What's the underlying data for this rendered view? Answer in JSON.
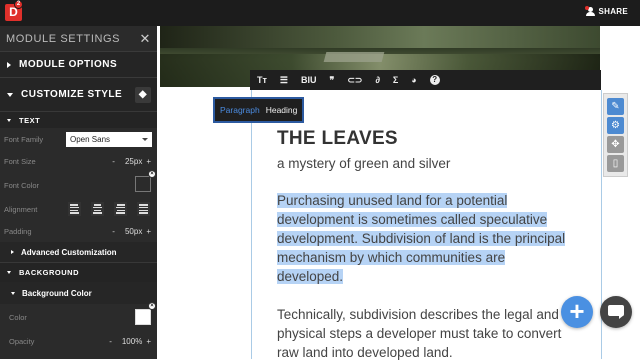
{
  "topbar": {
    "logo_letter": "D",
    "logo_badge": "2",
    "share_label": "SHARE"
  },
  "panel": {
    "header_title": "MODULE SETTINGS",
    "close_glyph": "✕",
    "module_options": "MODULE OPTIONS",
    "customize_style": "CUSTOMIZE STYLE",
    "text_section": "TEXT",
    "font_family_label": "Font Family",
    "font_family_value": "Open Sans",
    "font_size_label": "Font Size",
    "font_size_value": "25px",
    "font_color_label": "Font Color",
    "alignment_label": "Alignment",
    "padding_label": "Padding",
    "padding_value": "50px",
    "advanced_label": "Advanced Customization",
    "background_section": "BACKGROUND",
    "background_color_label": "Background Color",
    "color_label": "Color",
    "opacity_label": "Opacity",
    "opacity_value": "100%",
    "minus": "-",
    "plus": "+"
  },
  "toolbar": {
    "items": [
      "Tт",
      "☰",
      "BIU",
      "❞",
      "🔗",
      "📎",
      "Σ",
      "◕",
      "?"
    ]
  },
  "tabs": {
    "paragraph": "Paragraph",
    "heading": "Heading"
  },
  "content": {
    "title": "THE LEAVES",
    "subtitle": "a mystery of green and silver",
    "para1_lines": [
      "Purchasing unused land for a potential",
      "development is sometimes called speculative",
      "development. Subdivision of land is the principal",
      "mechanism by which communities are",
      "developed."
    ],
    "para2_lines": [
      "Technically, subdivision describes the legal and",
      "physical steps a developer must take to convert",
      "raw land into developed land."
    ]
  },
  "colors": {
    "accent": "#4a90e2",
    "panel_bg": "#2b2b2b",
    "highlight": "#b6d3f5"
  }
}
